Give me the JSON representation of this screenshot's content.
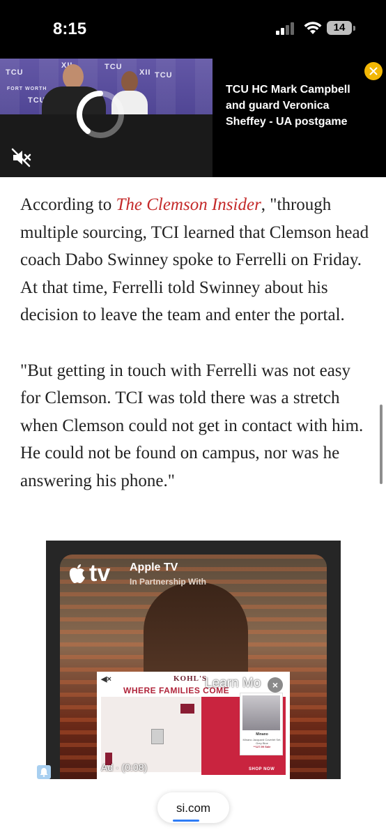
{
  "status_bar": {
    "time": "8:15",
    "battery": "14"
  },
  "video": {
    "title": "TCU HC Mark Campbell and guard Veronica Sheffey - UA postgame",
    "backdrop_logos": [
      "TCU",
      "XII",
      "TCU",
      "XII",
      "TCU",
      "TCU",
      "FORT WORTH"
    ],
    "accent_color": "#f2b705"
  },
  "article": {
    "paragraph1_before_link": "According to ",
    "paragraph1_link": "The Clemson Insider",
    "paragraph1_after_link": ", \"through multiple sourcing, TCI learned that Clemson head coach Dabo Swinney spoke to Ferrelli on Friday. At that time, Ferrelli told Swinney about his decision to leave the team and enter the portal.",
    "paragraph2": "\"But getting in touch with Ferrelli was not easy for Clemson. TCI was told there was a stretch when Clemson could not get in contact with him. He could not be found on campus, nor was he answering his phone.\"",
    "link_color": "#c42a2a"
  },
  "ad": {
    "logo_text": "tv",
    "brand": "Apple TV",
    "partner": "In Partnership With",
    "kohls_logo": "KOHL'S",
    "kohls_tagline": "WHERE FAMILIES COME",
    "learn_more": "Learn Mo",
    "close_label": "×",
    "timer": "Ad · (0:08)",
    "product_name": "Minano",
    "product_desc": "Minano Jacquard Coverlet Set, Grey Blue",
    "product_price": "**127.99 Sale",
    "shop_now": "SHOP NOW"
  },
  "url_bar": {
    "domain": "si.com",
    "progress": 0.37
  }
}
